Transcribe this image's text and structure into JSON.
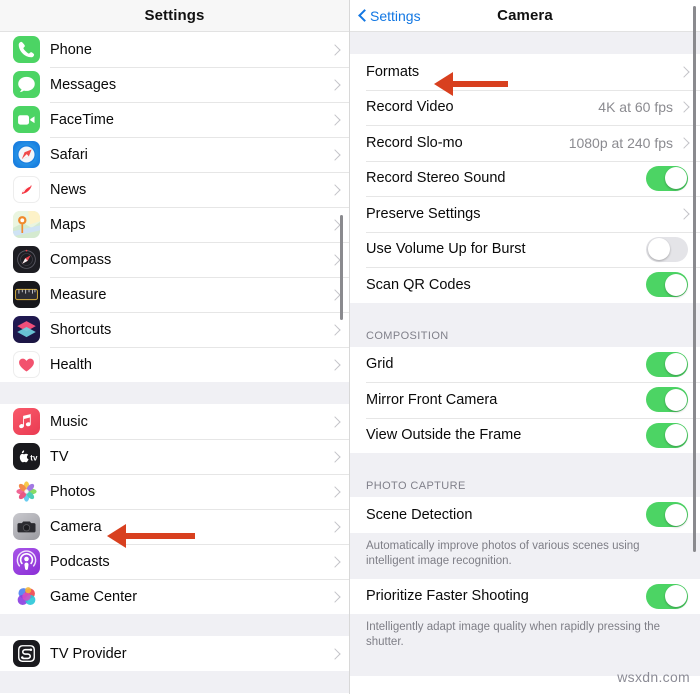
{
  "colors": {
    "accent_blue": "#1277e3",
    "toggle_on": "#4cd464",
    "toggle_off": "#e4e4e8",
    "arrow_red": "#d8401f",
    "group_bg": "#f0f0f4"
  },
  "left_pane": {
    "header": {
      "title": "Settings"
    },
    "groups": [
      {
        "rows": [
          {
            "label": "Phone",
            "icon": "phone-app-icon"
          },
          {
            "label": "Messages",
            "icon": "messages-app-icon"
          },
          {
            "label": "FaceTime",
            "icon": "facetime-app-icon"
          },
          {
            "label": "Safari",
            "icon": "safari-app-icon"
          },
          {
            "label": "News",
            "icon": "news-app-icon"
          },
          {
            "label": "Maps",
            "icon": "maps-app-icon"
          },
          {
            "label": "Compass",
            "icon": "compass-app-icon"
          },
          {
            "label": "Measure",
            "icon": "measure-app-icon"
          },
          {
            "label": "Shortcuts",
            "icon": "shortcuts-app-icon"
          },
          {
            "label": "Health",
            "icon": "health-app-icon"
          }
        ]
      },
      {
        "rows": [
          {
            "label": "Music",
            "icon": "music-app-icon"
          },
          {
            "label": "TV",
            "icon": "tv-app-icon"
          },
          {
            "label": "Photos",
            "icon": "photos-app-icon"
          },
          {
            "label": "Camera",
            "icon": "camera-app-icon"
          },
          {
            "label": "Podcasts",
            "icon": "podcasts-app-icon"
          },
          {
            "label": "Game Center",
            "icon": "game-center-app-icon"
          }
        ]
      },
      {
        "rows": [
          {
            "label": "TV Provider",
            "icon": "tv-provider-app-icon"
          }
        ]
      }
    ]
  },
  "right_pane": {
    "header": {
      "back_label": "Settings",
      "title": "Camera"
    },
    "group1": {
      "rows": [
        {
          "label": "Formats",
          "type": "disclosure",
          "value": ""
        },
        {
          "label": "Record Video",
          "type": "disclosure",
          "value": "4K at 60 fps"
        },
        {
          "label": "Record Slo-mo",
          "type": "disclosure",
          "value": "1080p at 240 fps"
        },
        {
          "label": "Record Stereo Sound",
          "type": "toggle",
          "on": true
        },
        {
          "label": "Preserve Settings",
          "type": "disclosure",
          "value": ""
        },
        {
          "label": "Use Volume Up for Burst",
          "type": "toggle",
          "on": false
        },
        {
          "label": "Scan QR Codes",
          "type": "toggle",
          "on": true
        }
      ]
    },
    "section_composition": {
      "header": "COMPOSITION",
      "rows": [
        {
          "label": "Grid",
          "type": "toggle",
          "on": true
        },
        {
          "label": "Mirror Front Camera",
          "type": "toggle",
          "on": true
        },
        {
          "label": "View Outside the Frame",
          "type": "toggle",
          "on": true
        }
      ]
    },
    "section_photo_capture": {
      "header": "PHOTO CAPTURE",
      "rows": [
        {
          "label": "Scene Detection",
          "type": "toggle",
          "on": true,
          "footnote": "Automatically improve photos of various scenes using intelligent image recognition."
        },
        {
          "label": "Prioritize Faster Shooting",
          "type": "toggle",
          "on": true,
          "footnote": "Intelligently adapt image quality when rapidly pressing the shutter."
        }
      ]
    }
  },
  "annotations": {
    "arrow_camera": {
      "target": "Camera"
    },
    "arrow_formats": {
      "target": "Formats"
    }
  },
  "watermark": {
    "text": "wsxdn.com"
  }
}
